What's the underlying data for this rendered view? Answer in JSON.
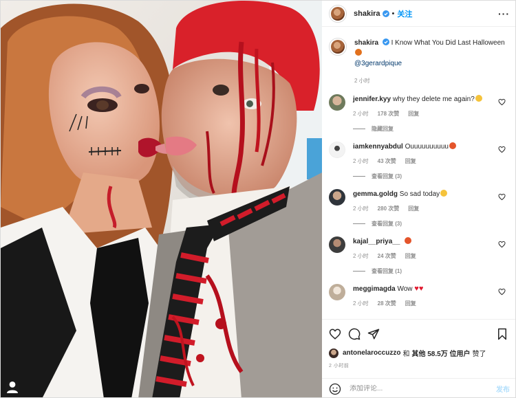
{
  "header": {
    "username": "shakira",
    "separator": "•",
    "follow_label": "关注",
    "more_label": "···"
  },
  "caption": {
    "username": "shakira",
    "text": "I Know What You Did Last Halloween",
    "mention": "@3gerardpique",
    "time": "2 小时"
  },
  "comments": [
    {
      "username": "jennifer.kyy",
      "text": "why they delete me again?",
      "time": "2 小时",
      "likes": "178 次赞",
      "reply": "回复",
      "replies_label": "隐藏回复",
      "avatar_color": "#8a8f7a"
    },
    {
      "username": "iamkennyabdul",
      "text": "Ouuuuuuuuuu",
      "time": "2 小时",
      "likes": "43 次赞",
      "reply": "回复",
      "replies_label": "查看回复 (3)",
      "avatar_color": "#f0f0f0"
    },
    {
      "username": "gemma.goldg",
      "text": "So sad today",
      "time": "2 小时",
      "likes": "280 次赞",
      "reply": "回复",
      "replies_label": "查看回复 (3)",
      "avatar_color": "#3a3f47"
    },
    {
      "username": "kajal__priya__",
      "text": "",
      "time": "2 小时",
      "likes": "24 次赞",
      "reply": "回复",
      "replies_label": "查看回复 (1)",
      "avatar_color": "#4a4a4a"
    },
    {
      "username": "meggimagda",
      "text": "Wow",
      "time": "2 小时",
      "likes": "28 次赞",
      "reply": "回复",
      "avatar_color": "#c9b9a6"
    }
  ],
  "likes": {
    "first_user": "antonelaroccuzzo",
    "connector": "和",
    "others": "其他 58.5万 位用户",
    "suffix": "赞了"
  },
  "post_time": "2 小时前",
  "add_comment": {
    "placeholder": "添加评论...",
    "post_label": "发布"
  },
  "icons": {
    "like": "heart-icon",
    "comment": "comment-icon",
    "share": "paper-plane-icon",
    "save": "bookmark-icon",
    "emoji": "smiley-icon",
    "verified": "verified-badge-icon"
  },
  "colors": {
    "link_blue": "#0095f6",
    "mention_blue": "#00376b",
    "meta_gray": "#8e8e8e",
    "post_disabled": "#b2dffc",
    "heart_red": "#ed4956"
  }
}
